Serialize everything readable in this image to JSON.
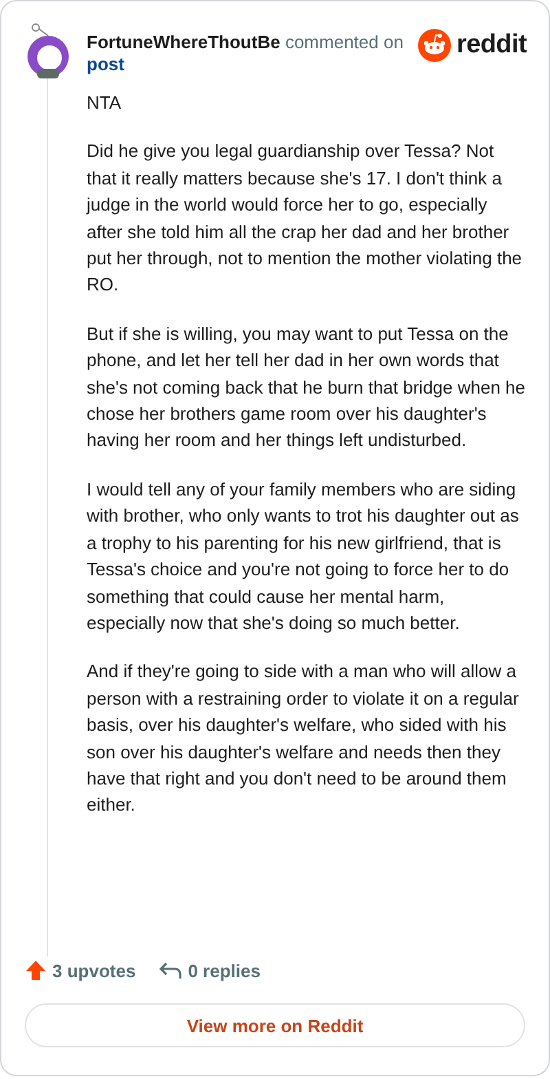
{
  "header": {
    "author": "FortuneWhereThoutBe",
    "action": "commented on",
    "link": "post",
    "brand": "reddit"
  },
  "paragraphs": [
    "NTA",
    "Did he give you legal guardianship over Tessa? Not that it really matters because she's 17. I don't think a judge in the world would force her to go, especially after she told him all the crap her dad and her brother put her through, not to mention the mother violating the RO.",
    "But if she is willing, you may want to put Tessa on the phone, and let her tell her dad in her own words that she's not coming back that he burn that bridge when he chose her brothers game room over his daughter's having her room and her things left undisturbed.",
    "I would tell any of your family members who are siding with brother, who only wants to trot his daughter out as a trophy to his parenting for his new girlfriend, that is Tessa's choice and you're not going to force her to do something that could cause her mental harm, especially now that she's doing so much better.",
    "And if they're going to side with a man who will allow a person with a restraining order to violate it on a regular basis, over his daughter's welfare, who sided with his son over his daughter's welfare and needs then they have that right and you don't need to be around them either."
  ],
  "footer": {
    "upvotes": "3 upvotes",
    "replies": "0 replies",
    "button": "View more on Reddit"
  }
}
